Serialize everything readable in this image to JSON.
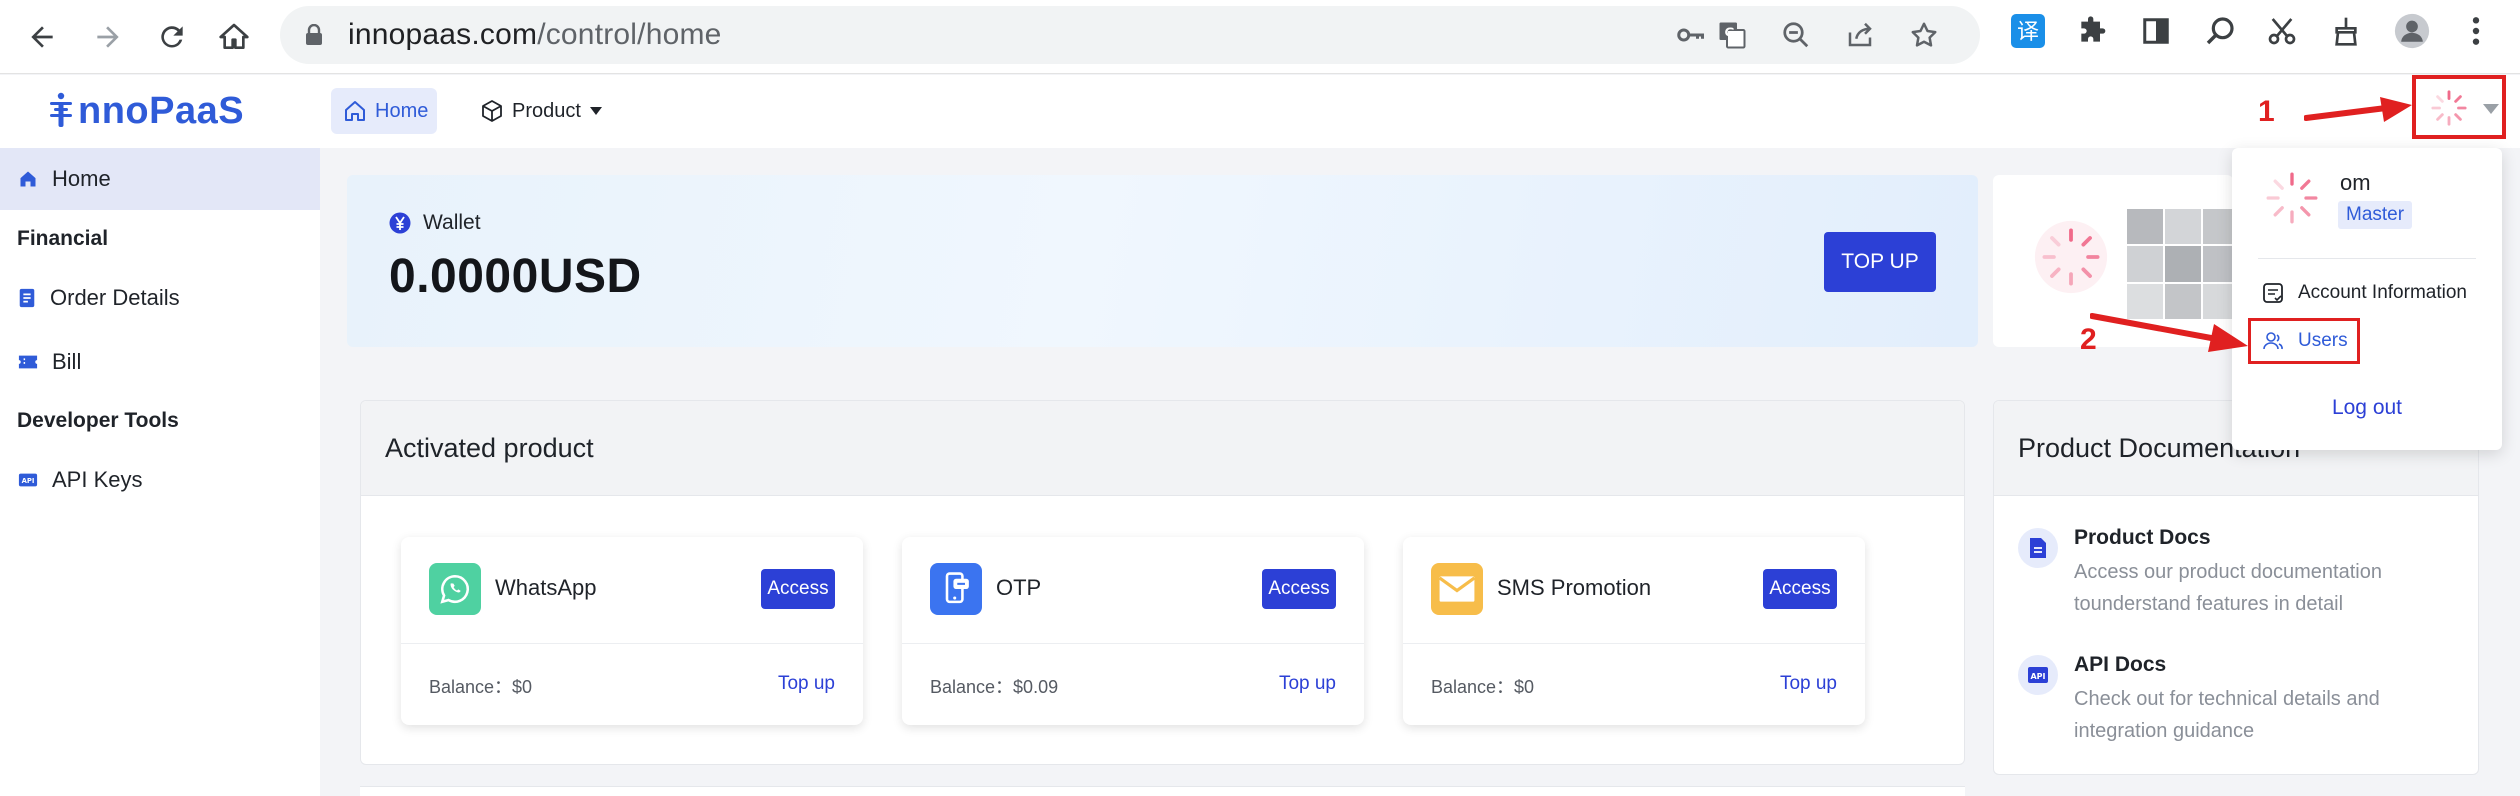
{
  "browser": {
    "url_host": "innopaas.com",
    "url_path": "/control/home",
    "translate_badge": "译"
  },
  "header": {
    "logo_text": "nnoPaaS",
    "nav": [
      {
        "label": "Home"
      },
      {
        "label": "Product"
      }
    ]
  },
  "sidebar": {
    "home": "Home",
    "groups": [
      {
        "title": "Financial",
        "items": [
          {
            "label": "Order Details"
          },
          {
            "label": "Bill"
          }
        ]
      },
      {
        "title": "Developer Tools",
        "items": [
          {
            "label": "API Keys"
          }
        ]
      }
    ]
  },
  "wallet": {
    "label": "Wallet",
    "amount": "0.0000USD",
    "topup_label": "TOP UP"
  },
  "activated": {
    "title": "Activated product",
    "products": [
      {
        "name": "WhatsApp",
        "access": "Access",
        "balance": "Balance：$0",
        "topup": "Top up",
        "color": "#4fd1a1"
      },
      {
        "name": "OTP",
        "access": "Access",
        "balance": "Balance：$0.09",
        "topup": "Top up",
        "color": "#3b74f0"
      },
      {
        "name": "SMS Promotion",
        "access": "Access",
        "balance": "Balance：$0",
        "topup": "Top up",
        "color": "#f7bd4a"
      }
    ]
  },
  "docs": {
    "title": "Product Documentation",
    "items": [
      {
        "title": "Product Docs",
        "desc": "Access our product documentation tounderstand features in detail"
      },
      {
        "title": "API Docs",
        "desc": "Check out for technical details and integration guidance"
      }
    ]
  },
  "dropdown": {
    "name": "om",
    "role": "Master",
    "items": [
      {
        "label": "Account Information"
      },
      {
        "label": "Users"
      }
    ],
    "logout": "Log out"
  },
  "annotations": {
    "step1": "1",
    "step2": "2"
  },
  "colors": {
    "accent": "#2c40d6",
    "annotation": "#e02020"
  }
}
